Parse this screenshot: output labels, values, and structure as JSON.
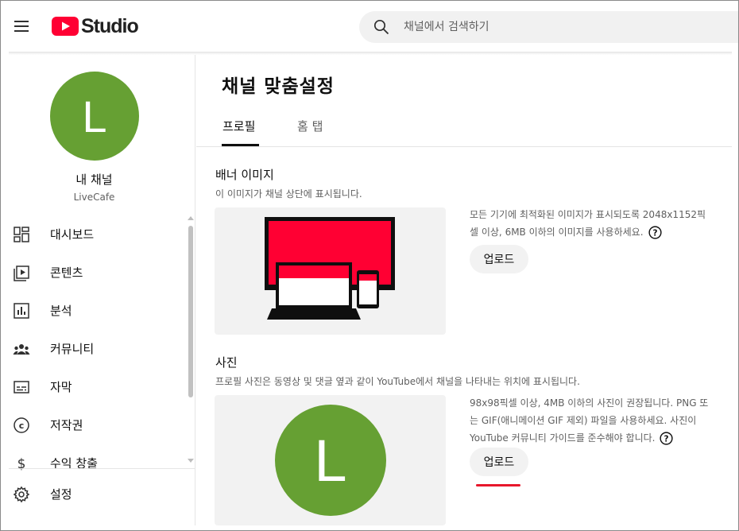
{
  "header": {
    "logo_text": "Studio",
    "search_placeholder": "채널에서 검색하기"
  },
  "sidebar": {
    "avatar_letter": "L",
    "my_channel": "내 채널",
    "channel_name": "LiveCafe",
    "items": [
      {
        "label": "대시보드",
        "icon": "dashboard-icon"
      },
      {
        "label": "콘텐츠",
        "icon": "content-icon"
      },
      {
        "label": "분석",
        "icon": "analytics-icon"
      },
      {
        "label": "커뮤니티",
        "icon": "community-icon"
      },
      {
        "label": "자막",
        "icon": "subtitles-icon"
      },
      {
        "label": "저작권",
        "icon": "copyright-icon"
      },
      {
        "label": "수익 창출",
        "icon": "monetization-icon"
      }
    ],
    "settings_label": "설정"
  },
  "main": {
    "title": "채널 맞춤설정",
    "tabs": [
      {
        "label": "프로필",
        "active": true
      },
      {
        "label": "홈 탭",
        "active": false
      }
    ],
    "banner": {
      "title": "배너 이미지",
      "description": "이 이미지가 채널 상단에 표시됩니다.",
      "info_line1": "모든 기기에 최적화된 이미지가 표시되도록 2048x1152픽",
      "info_line2": "셀 이상, 6MB 이하의 이미지를 사용하세요.",
      "upload_label": "업로드"
    },
    "photo": {
      "title": "사진",
      "description": "프로필 사진은 동영상 및 댓글 옆과 같이 YouTube에서 채널을 나타내는 위치에 표시됩니다.",
      "avatar_letter": "L",
      "info_line1": "98x98픽셀 이상, 4MB 이하의 사진이 권장됩니다. PNG 또",
      "info_line2": "는 GIF(애니메이션 GIF 제외) 파일을 사용하세요. 사진이",
      "info_line3": "YouTube 커뮤니티 가이드를 준수해야 합니다.",
      "upload_label": "업로드"
    }
  },
  "colors": {
    "accent_red": "#ff0033",
    "avatar_green": "#66a033",
    "annotation_red": "#e8172b"
  }
}
